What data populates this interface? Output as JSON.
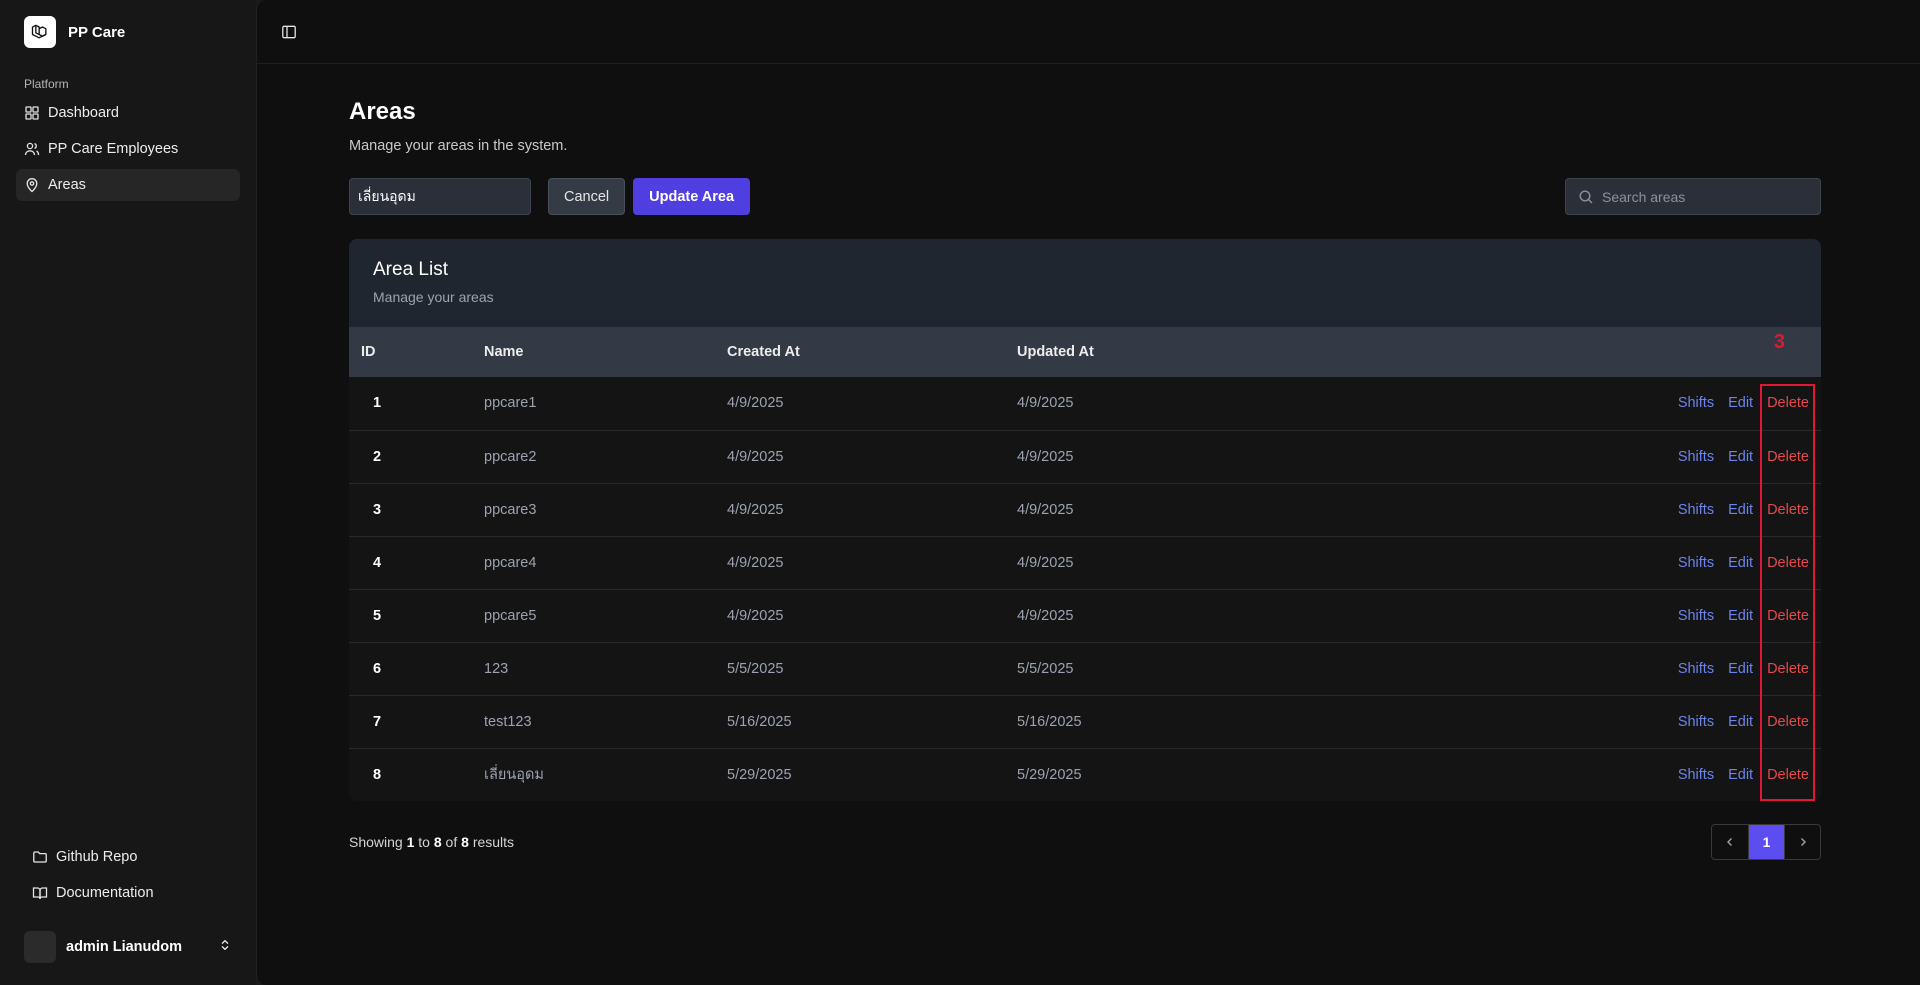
{
  "app": {
    "name": "PP Care",
    "logo_icon": "laravel-logo-icon"
  },
  "sidebar": {
    "group_label": "Platform",
    "items": [
      {
        "label": "Dashboard",
        "icon": "grid-icon",
        "active": false
      },
      {
        "label": "PP Care Employees",
        "icon": "users-icon",
        "active": false
      },
      {
        "label": "Areas",
        "icon": "map-pin-icon",
        "active": true
      }
    ],
    "footer": [
      {
        "label": "Github Repo",
        "icon": "folder-icon"
      },
      {
        "label": "Documentation",
        "icon": "book-open-icon"
      }
    ],
    "user": {
      "name": "admin Lianudom",
      "icon": "chevrons-up-down-icon"
    }
  },
  "page": {
    "title": "Areas",
    "subtitle": "Manage your areas in the system."
  },
  "toolbar": {
    "name_value": "เลี่ยนอุดม",
    "cancel_label": "Cancel",
    "update_label": "Update Area",
    "search_placeholder": "Search areas"
  },
  "card": {
    "title": "Area List",
    "subtitle": "Manage your areas"
  },
  "table": {
    "columns": [
      "ID",
      "Name",
      "Created At",
      "Updated At"
    ],
    "annotation": "3",
    "actions": {
      "shifts": "Shifts",
      "edit": "Edit",
      "delete": "Delete"
    },
    "rows": [
      {
        "id": "1",
        "name": "ppcare1",
        "created": "4/9/2025",
        "updated": "4/9/2025"
      },
      {
        "id": "2",
        "name": "ppcare2",
        "created": "4/9/2025",
        "updated": "4/9/2025"
      },
      {
        "id": "3",
        "name": "ppcare3",
        "created": "4/9/2025",
        "updated": "4/9/2025"
      },
      {
        "id": "4",
        "name": "ppcare4",
        "created": "4/9/2025",
        "updated": "4/9/2025"
      },
      {
        "id": "5",
        "name": "ppcare5",
        "created": "4/9/2025",
        "updated": "4/9/2025"
      },
      {
        "id": "6",
        "name": "123",
        "created": "5/5/2025",
        "updated": "5/5/2025"
      },
      {
        "id": "7",
        "name": "test123",
        "created": "5/16/2025",
        "updated": "5/16/2025"
      },
      {
        "id": "8",
        "name": "เลี่ยนอุดม",
        "created": "5/29/2025",
        "updated": "5/29/2025"
      }
    ]
  },
  "pagination": {
    "showing_prefix": "Showing",
    "from": "1",
    "to_word": "to",
    "to": "8",
    "of_word": "of",
    "total": "8",
    "results_word": "results",
    "current_page": "1"
  },
  "colors": {
    "accent": "#4f3ee0",
    "link": "#6d84ea",
    "danger": "#e5484d",
    "highlight": "#e01835"
  }
}
